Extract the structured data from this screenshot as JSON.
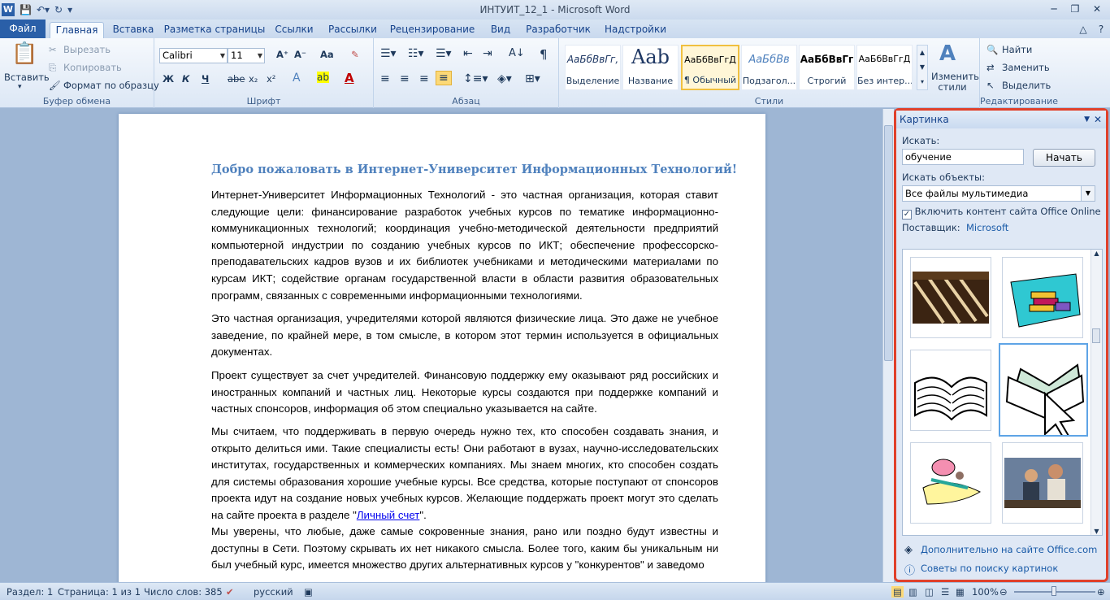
{
  "window": {
    "title": "ИНТУИТ_12_1  -  Microsoft Word",
    "qat_icons": [
      "word-logo-icon",
      "save-icon",
      "undo-icon",
      "redo-icon",
      "customize-icon"
    ]
  },
  "tabs": [
    "Файл",
    "Главная",
    "Вставка",
    "Разметка страницы",
    "Ссылки",
    "Рассылки",
    "Рецензирование",
    "Вид",
    "Разработчик",
    "Надстройки"
  ],
  "clipboard": {
    "paste": "Вставить",
    "cut": "Вырезать",
    "copy": "Копировать",
    "format_painter": "Формат по образцу",
    "label": "Буфер обмена"
  },
  "font": {
    "name": "Calibri",
    "size": "11",
    "label": "Шрифт",
    "bold": "Ж",
    "italic": "К",
    "underline": "Ч",
    "strike": "abe",
    "sub": "x₂",
    "sup": "x²",
    "grow": "A⁺",
    "shrink": "A⁻",
    "case": "Aa"
  },
  "paragraph": {
    "label": "Абзац"
  },
  "styles": {
    "label": "Стили",
    "items": [
      {
        "sample": "АаБбВвГг,",
        "name": "Выделение"
      },
      {
        "sample": "Aab",
        "name": "Название"
      },
      {
        "sample": "АаБбВвГгД",
        "name": "¶ Обычный"
      },
      {
        "sample": "АаБбВв",
        "name": "Подзагол..."
      },
      {
        "sample": "АаБбВвГг",
        "name": "Строгий"
      },
      {
        "sample": "АаБбВвГгД",
        "name": "Без интер..."
      }
    ],
    "change": "Изменить стили"
  },
  "editing": {
    "find": "Найти",
    "replace": "Заменить",
    "select": "Выделить",
    "label": "Редактирование"
  },
  "doc": {
    "heading": "Добро пожаловать в Интернет-Университет Информационных Технологий!",
    "p1": "Интернет-Университет Информационных Технологий - это частная организация, которая ставит следующие цели:  финансирование разработок учебных курсов по тематике информационно-коммуникационных технологий; координация учебно-методической деятельности предприятий компьютерной индустрии по созданию учебных курсов по ИКТ; обеспечение профессорско-преподавательских кадров вузов и их библиотек учебниками и методическими материалами по курсам ИКТ; содействие органам государственной власти в области развития образовательных программ, связанных с современными информационными технологиями.",
    "p2": "Это частная организация, учредителями которой являются физические лица. Это даже не учебное заведение, по крайней мере, в том смысле, в котором этот термин используется в официальных документах.",
    "p3": "Проект существует за счет учредителей. Финансовую поддержку ему оказывают ряд российских и иностранных компаний и частных лиц. Некоторые курсы создаются при поддержке компаний и частных спонсоров, информация об этом специально указывается на сайте.",
    "p4": "Мы считаем, что поддерживать в первую очередь нужно тех, кто способен создавать знания, и открыто делиться ими. Такие специалисты есть! Они работают в вузах, научно-исследовательских институтах, государственных и коммерческих компаниях. Мы знаем многих, кто способен создать для системы образования хорошие учебные курсы. Все средства, которые поступают от спонсоров проекта идут на создание новых учебных курсов. Желающие поддержать проект могут это сделать на сайте проекта в разделе \"",
    "p4_link": "Личный счет",
    "p4_end": "\".",
    "p5": "Мы уверены, что любые, даже самые сокровенные знания, рано или поздно будут известны и доступны в Сети. Поэтому скрывать их нет никакого смысла. Более того, каким бы уникальным ни был учебный курс, имеется множество других альтернативных курсов у \"конкурентов\" и заведомо"
  },
  "pane": {
    "title": "Картинка",
    "search_label": "Искать:",
    "search_value": "обучение",
    "go": "Начать",
    "objects_label": "Искать объекты:",
    "objects_value": "Все файлы мультимедиа",
    "include_online": "Включить контент сайта Office Online",
    "provider_label": "Поставщик:",
    "provider": "Microsoft",
    "more_link": "Дополнительно на сайте Office.com",
    "tips_link": "Советы по поиску картинок"
  },
  "status": {
    "section": "Раздел: 1",
    "page": "Страница: 1 из 1",
    "words": "Число слов: 385",
    "lang": "русский",
    "zoom": "100%"
  }
}
